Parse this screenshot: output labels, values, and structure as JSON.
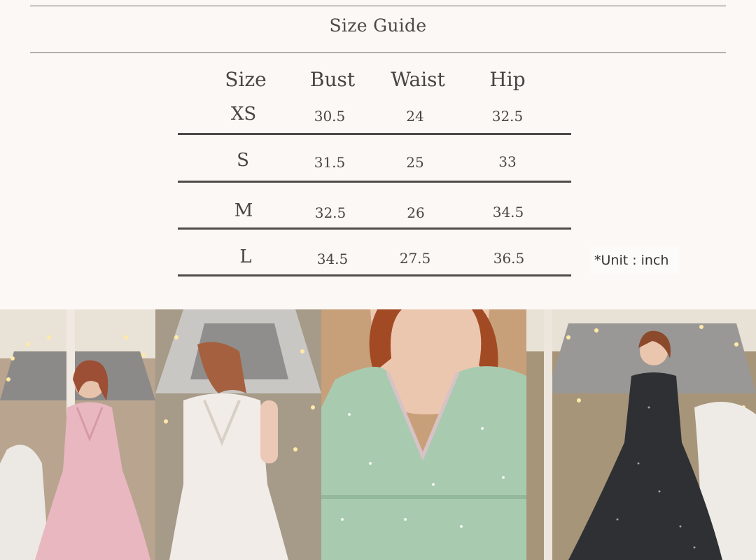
{
  "title": "Size Guide",
  "headers": [
    "Size",
    "Bust",
    "Waist",
    "Hip"
  ],
  "rows": [
    {
      "size": "XS",
      "bust": "30.5",
      "waist": "24",
      "hip": "32.5"
    },
    {
      "size": "S",
      "bust": "31.5",
      "waist": "25",
      "hip": "33"
    },
    {
      "size": "M",
      "bust": "32.5",
      "waist": "26",
      "hip": "34.5"
    },
    {
      "size": "L",
      "bust": "34.5",
      "waist": "27.5",
      "hip": "36.5"
    }
  ],
  "unit_note": "*Unit : inch",
  "photos": [
    {
      "name": "pink-dress-photo",
      "dress_color": "#e9b7c0"
    },
    {
      "name": "white-dress-photo",
      "dress_color": "#f1ece8"
    },
    {
      "name": "green-dress-photo",
      "dress_color": "#a8cbb0"
    },
    {
      "name": "black-dress-photo",
      "dress_color": "#2f3034"
    }
  ]
}
